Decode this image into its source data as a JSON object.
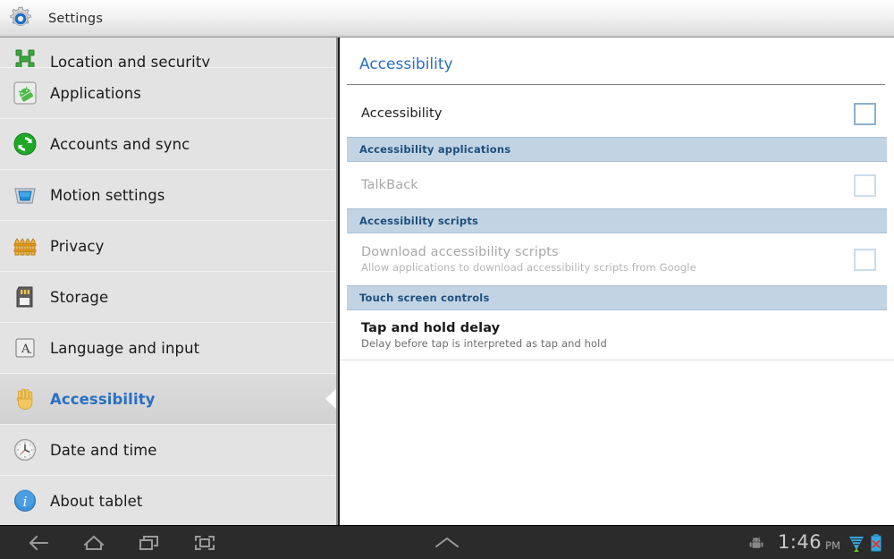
{
  "actionbar": {
    "icon": "settings-gear-icon",
    "title": "Settings"
  },
  "sidebar": {
    "items": [
      {
        "label": "Location and security",
        "icon": "location-security-icon",
        "selected": false,
        "clipped": true
      },
      {
        "label": "Applications",
        "icon": "applications-android-icon",
        "selected": false
      },
      {
        "label": "Accounts and sync",
        "icon": "accounts-sync-icon",
        "selected": false
      },
      {
        "label": "Motion settings",
        "icon": "motion-settings-icon",
        "selected": false
      },
      {
        "label": "Privacy",
        "icon": "privacy-fence-icon",
        "selected": false
      },
      {
        "label": "Storage",
        "icon": "storage-sdcard-icon",
        "selected": false
      },
      {
        "label": "Language and input",
        "icon": "language-input-icon",
        "selected": false
      },
      {
        "label": "Accessibility",
        "icon": "accessibility-hand-icon",
        "selected": true
      },
      {
        "label": "Date and time",
        "icon": "date-time-clock-icon",
        "selected": false
      },
      {
        "label": "About tablet",
        "icon": "about-tablet-info-icon",
        "selected": false
      }
    ]
  },
  "content": {
    "title": "Accessibility",
    "rows": [
      {
        "kind": "checkbox",
        "name": "accessibility-master",
        "title": "Accessibility",
        "summary": "",
        "enabled": true,
        "checked": false
      },
      {
        "kind": "section",
        "name": "accessibility-applications",
        "title": "Accessibility applications"
      },
      {
        "kind": "checkbox",
        "name": "talkback",
        "title": "TalkBack",
        "summary": "",
        "enabled": false,
        "checked": false
      },
      {
        "kind": "section",
        "name": "accessibility-scripts",
        "title": "Accessibility scripts"
      },
      {
        "kind": "checkbox",
        "name": "download-accessibility-scripts",
        "title": "Download accessibility scripts",
        "summary": "Allow applications to download accessibility scripts from Google",
        "enabled": false,
        "checked": false
      },
      {
        "kind": "section",
        "name": "touch-screen-controls",
        "title": "Touch screen controls"
      },
      {
        "kind": "plain",
        "name": "tap-and-hold-delay",
        "title": "Tap and hold delay",
        "summary": "Delay before tap is interpreted as tap and hold",
        "enabled": true
      }
    ]
  },
  "systembar": {
    "nav": [
      {
        "name": "back-button",
        "icon": "back-arrow-icon"
      },
      {
        "name": "home-button",
        "icon": "home-icon"
      },
      {
        "name": "recents-button",
        "icon": "recent-apps-icon"
      },
      {
        "name": "screenshot-button",
        "icon": "screenshot-icon"
      }
    ],
    "handle": {
      "name": "notification-handle",
      "icon": "chevron-up-icon"
    },
    "status": {
      "notification_icon": "android-robot-icon",
      "time": "1:46",
      "ampm": "PM",
      "signal_icon": "wifi-signal-icon",
      "battery_icon": "battery-error-icon"
    }
  },
  "colors": {
    "accent_blue": "#2a6fc4",
    "section_bg": "#c2d4e4",
    "section_text": "#1d4f7c",
    "sidebar_bg": "#e3e3e3",
    "sysbar_bg": "#2b2b2b"
  }
}
